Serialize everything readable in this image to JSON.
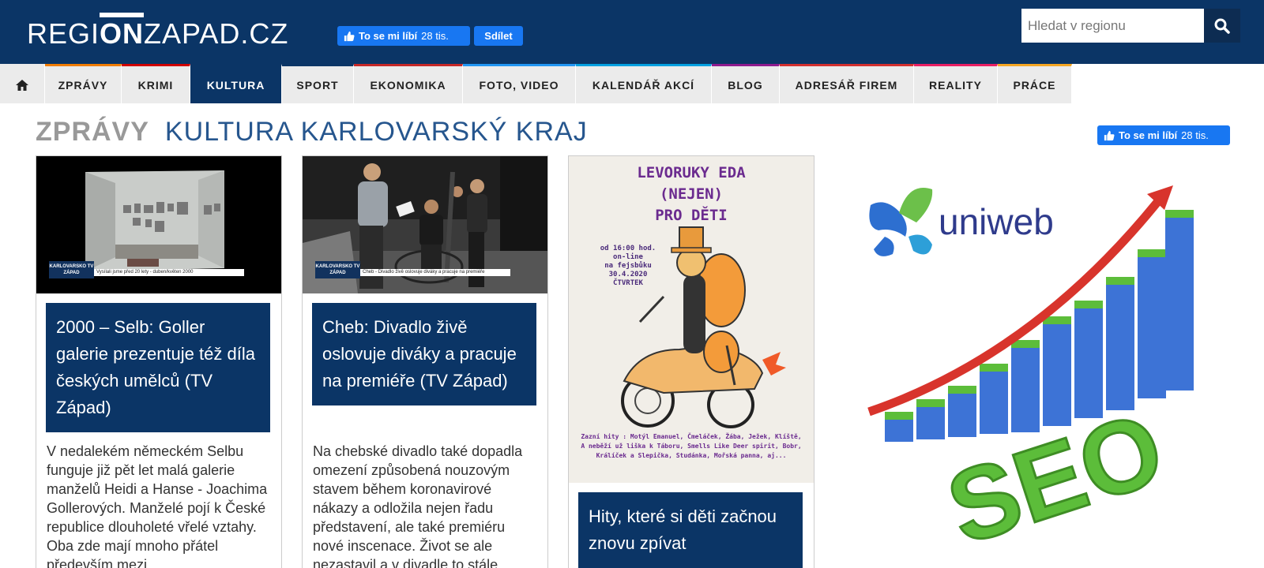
{
  "header": {
    "logo": {
      "part1": "REGI",
      "part2": "ON",
      "part3": "ZAPAD.CZ"
    },
    "fb_like_label": "To se mi líbí",
    "fb_like_count": "28 tis.",
    "fb_share_label": "Sdílet",
    "search_placeholder": "Hledat v regionu"
  },
  "nav": {
    "items": [
      {
        "label": "ZPRÁVY",
        "color": "#ff6600"
      },
      {
        "label": "KRIMI",
        "color": "#cc0000"
      },
      {
        "label": "KULTURA",
        "color": "#0b3566"
      },
      {
        "label": "SPORT",
        "color": "#0b3566"
      },
      {
        "label": "EKONOMIKA",
        "color": "#cc0000"
      },
      {
        "label": "FOTO, VIDEO",
        "color": "#2196f3"
      },
      {
        "label": "KALENDÁŘ AKCÍ",
        "color": "#00a0e0"
      },
      {
        "label": "BLOG",
        "color": "#8e1a8e"
      },
      {
        "label": "ADRESÁŘ FIREM",
        "color": "#d32f2f"
      },
      {
        "label": "REALITY",
        "color": "#e91e63"
      },
      {
        "label": "PRÁCE",
        "color": "#f5a623"
      }
    ]
  },
  "main": {
    "section_prefix": "ZPRÁVY",
    "section_title": "KULTURA KARLOVARSKÝ KRAJ",
    "fb_like_label": "To se mi líbí",
    "fb_like_count": "28 tis."
  },
  "articles": [
    {
      "title": "2000 – Selb: Goller galerie prezentuje též díla českých umělců (TV Západ)",
      "perex": "V nedalekém německém Selbu funguje již pět let malá galerie manželů Heidi a Hanse - Joachima Gollerových. Manželé pojí k České republice dlouholeté vřelé vztahy. Oba zde mají mnoho přátel především mezi",
      "tv_tag": "KARLOVARSKO TV ZÁPAD",
      "tv_caption": "Vysílali jsme před 20 lety - duben/květen 2000"
    },
    {
      "title": "Cheb: Divadlo živě oslovuje diváky a pracuje na premiéře (TV Západ)",
      "perex": "Na chebské divadlo také dopadla omezení způsobená nouzovým stavem během koronavirové nákazy a odložila nejen řadu představení, ale také premiéru nové inscenace. Život se ale nezastavil a v divadle to stále",
      "tv_tag": "KARLOVARSKO TV ZÁPAD",
      "tv_caption": "Cheb - Divadlo živě oslovuje diváky a pracuje na premiéře"
    },
    {
      "title": "Hity, které si děti začnou znovu zpívat",
      "poster_title": [
        "LEVORUKY EDA",
        "(NEJEN)",
        "PRO DĚTI"
      ],
      "poster_info": [
        "od 16:00 hod.",
        "on-line",
        "na fejsbůku",
        "30.4.2020",
        "ČTVRTEK"
      ],
      "poster_footer": [
        "Zazní hity : Motýl Emanuel, Čmeláček, Žába, Ježek, Klíště,",
        "A neběží už liška k Táboru, Smells Like Deer spirit, Bobr,",
        "Králíček a Slepička, Studánka, Mořská panna, aj..."
      ]
    }
  ],
  "ad": {
    "brand": "uniweb",
    "text": "SEO"
  }
}
